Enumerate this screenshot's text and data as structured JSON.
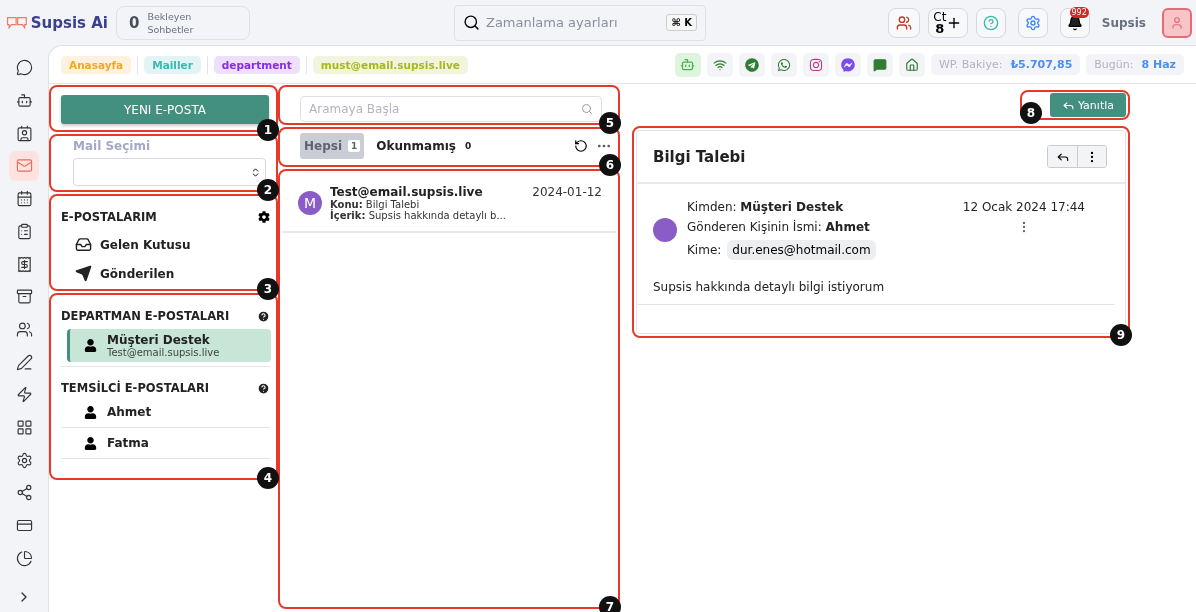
{
  "app": {
    "logo": "Supsis Ai"
  },
  "waiting": {
    "count": "0",
    "label": "Bekleyen Sohbetler"
  },
  "search": {
    "placeholder": "Zamanlama ayarları",
    "shortcut": "⌘ K"
  },
  "header": {
    "counter_label": "Ct",
    "counter_value": "8",
    "notification_count": "992",
    "user": "Supsis"
  },
  "breadcrumbs": [
    {
      "label": "Anasayfa",
      "color": "#f5a623"
    },
    {
      "label": "Mailler",
      "color": "#3bb8b0"
    },
    {
      "label": "department",
      "color": "#8a2be2"
    },
    {
      "label": "must@email.supsis.live",
      "color": "#a8b820"
    }
  ],
  "balance": {
    "label": "WP. Bakiye:",
    "value": "₺5.707,85"
  },
  "today": {
    "label": "Bugün:",
    "value": "8 Haz"
  },
  "sidebar": {
    "items": [
      {
        "selected": false
      },
      {
        "selected": false
      },
      {
        "selected": false
      },
      {
        "selected": true
      },
      {
        "selected": false
      },
      {
        "selected": false
      },
      {
        "selected": false
      },
      {
        "selected": false
      },
      {
        "selected": false
      },
      {
        "selected": false
      },
      {
        "selected": false
      },
      {
        "selected": false
      },
      {
        "selected": false
      },
      {
        "selected": false
      },
      {
        "selected": false
      },
      {
        "selected": false
      }
    ]
  },
  "compose_button": "YENI E-POSTA",
  "mail_select": {
    "label": "Mail Seçimi"
  },
  "my_mails": {
    "title": "E-POSTALARIM",
    "items": [
      "Gelen Kutusu",
      "Gönderilen"
    ]
  },
  "department_mails": {
    "title": "DEPARTMAN E-POSTALARI",
    "items": [
      {
        "name": "Müşteri Destek",
        "email": "Test@email.supsis.live",
        "selected": true
      }
    ]
  },
  "rep_mails": {
    "title": "TEMSİLCİ E-POSTALARI",
    "items": [
      {
        "name": "Ahmet",
        "selected": false
      },
      {
        "name": "Fatma",
        "selected": false
      }
    ]
  },
  "list_search": {
    "placeholder": "Aramaya Başla"
  },
  "filters": [
    {
      "label": "Hepsi",
      "count": "1",
      "selected": true
    },
    {
      "label": "Okunmamış",
      "count": "0",
      "selected": false
    }
  ],
  "messages": [
    {
      "avatar": "M",
      "from": "Test@email.supsis.live",
      "date": "2024-01-12",
      "subject": "**Konu:** Bilgi Talebi",
      "content": "**İçerik:** Supsis hakkında detaylı b..."
    }
  ],
  "reply_button": "Yanıtla",
  "detail": {
    "title": "Bilgi Talebi",
    "from": "Kimden: **Müşteri Destek**",
    "sender": "Gönderen Kişinin İsmi: **Ahmet**",
    "to_label": "Kime:",
    "to": "dur.enes@hotmail.com",
    "date": "12 Ocak 2024 17:44",
    "body": "Supsis hakkında detaylı bilgi istiyorum"
  },
  "annotations": [
    "1",
    "2",
    "3",
    "4",
    "5",
    "6",
    "7",
    "8",
    "9"
  ]
}
